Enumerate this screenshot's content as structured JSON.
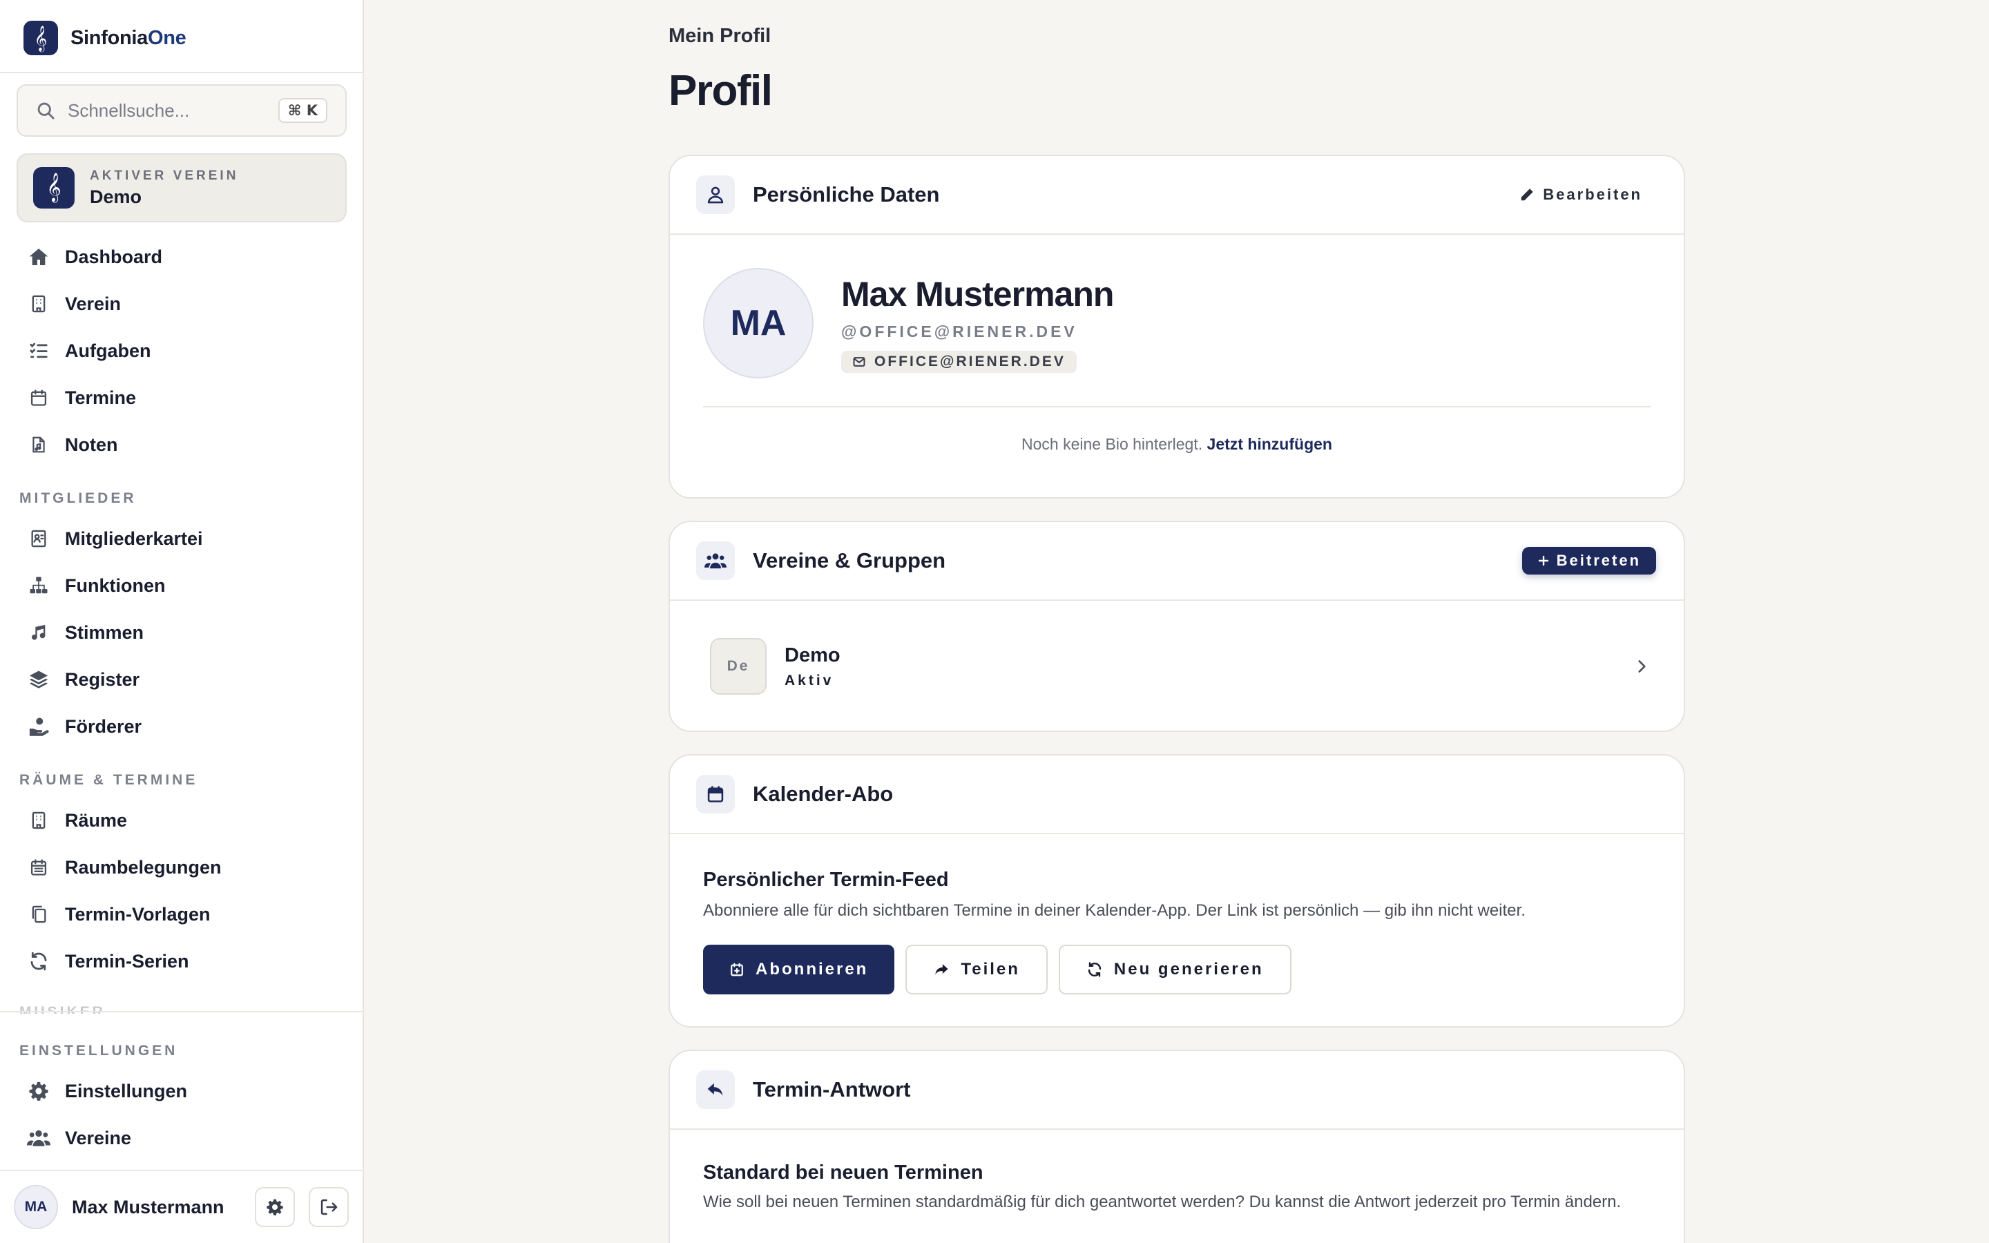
{
  "app": {
    "brand_prefix": "Sinfonia",
    "brand_suffix": "One",
    "search_placeholder": "Schnellsuche...",
    "search_shortcut": "⌘ K",
    "active_club_label": "AKTIVER VEREIN",
    "active_club_name": "Demo"
  },
  "nav": {
    "main": [
      {
        "label": "Dashboard",
        "icon": "home-icon"
      },
      {
        "label": "Verein",
        "icon": "building-icon"
      },
      {
        "label": "Aufgaben",
        "icon": "tasks-icon"
      },
      {
        "label": "Termine",
        "icon": "calendar-icon"
      },
      {
        "label": "Noten",
        "icon": "sheet-music-icon"
      }
    ],
    "section_members": "MITGLIEDER",
    "members": [
      {
        "label": "Mitgliederkartei",
        "icon": "id-card-icon"
      },
      {
        "label": "Funktionen",
        "icon": "org-chart-icon"
      },
      {
        "label": "Stimmen",
        "icon": "music-note-icon"
      },
      {
        "label": "Register",
        "icon": "layers-icon"
      },
      {
        "label": "Förderer",
        "icon": "donor-hand-icon"
      }
    ],
    "section_rooms": "RÄUME & TERMINE",
    "rooms": [
      {
        "label": "Räume",
        "icon": "building-icon"
      },
      {
        "label": "Raumbelegungen",
        "icon": "calendar-grid-icon"
      },
      {
        "label": "Termin-Vorlagen",
        "icon": "copy-icon"
      },
      {
        "label": "Termin-Serien",
        "icon": "repeat-icon"
      }
    ],
    "section_peek": "MUSIKER",
    "section_settings": "EINSTELLUNGEN",
    "settings": [
      {
        "label": "Einstellungen",
        "icon": "gear-icon"
      },
      {
        "label": "Vereine",
        "icon": "users-icon"
      }
    ]
  },
  "user": {
    "initials": "MA",
    "name": "Max Mustermann"
  },
  "page": {
    "breadcrumb": "Mein Profil",
    "title": "Profil"
  },
  "personal": {
    "title": "Persönliche Daten",
    "edit_label": "Bearbeiten",
    "initials": "MA",
    "name": "Max Mustermann",
    "handle": "@OFFICE@RIENER.DEV",
    "email": "OFFICE@RIENER.DEV",
    "bio_empty": "Noch keine Bio hinterlegt.",
    "bio_add": "Jetzt hinzufügen"
  },
  "clubs": {
    "title": "Vereine & Gruppen",
    "join_label": "Beitreten",
    "items": [
      {
        "abbr": "De",
        "name": "Demo",
        "status": "Aktiv"
      }
    ]
  },
  "calendar": {
    "title": "Kalender-Abo",
    "feed_title": "Persönlicher Termin-Feed",
    "feed_text": "Abonniere alle für dich sichtbaren Termine in deiner Kalender-App. Der Link ist persönlich — gib ihn nicht weiter.",
    "subscribe_label": "Abonnieren",
    "share_label": "Teilen",
    "regenerate_label": "Neu generieren"
  },
  "reply": {
    "title": "Termin-Antwort",
    "default_title": "Standard bei neuen Terminen",
    "default_text": "Wie soll bei neuen Terminen standardmäßig für dich geantwortet werden? Du kannst die Antwort jederzeit pro Termin ändern."
  },
  "colors": {
    "primary": "#1f2a5c",
    "background": "#f6f5f2"
  }
}
